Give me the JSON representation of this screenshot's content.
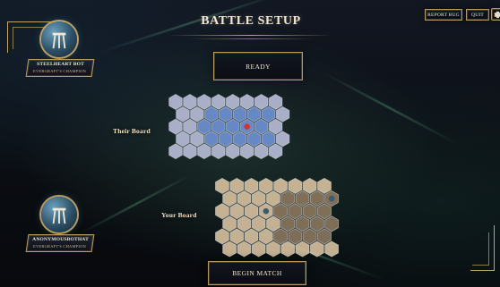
{
  "header": {
    "title": "BATTLE SETUP",
    "buttons": {
      "report_label": "REPORT BUG",
      "quit_label": "QUIT"
    }
  },
  "players": [
    {
      "name": "STEELHEART BOT",
      "subtitle": "EVERGRAFT'S CHAMPION"
    },
    {
      "name": "ANONYMOUSBOTHAT",
      "subtitle": "EVERGRAFT'S CHAMPION"
    }
  ],
  "buttons": {
    "ready_label": "READY",
    "begin_label": "BEGIN MATCH"
  },
  "boards": {
    "their_label": "Their Board",
    "your_label": "Your Board"
  },
  "colors": {
    "gold": "#d6b36f",
    "their_board_hex": "#b9bedb",
    "their_highlight": "#6f93d6",
    "your_board_hex": "#d8c2a0",
    "your_highlight": "#8b785e",
    "red_marker": "#d9302b"
  }
}
